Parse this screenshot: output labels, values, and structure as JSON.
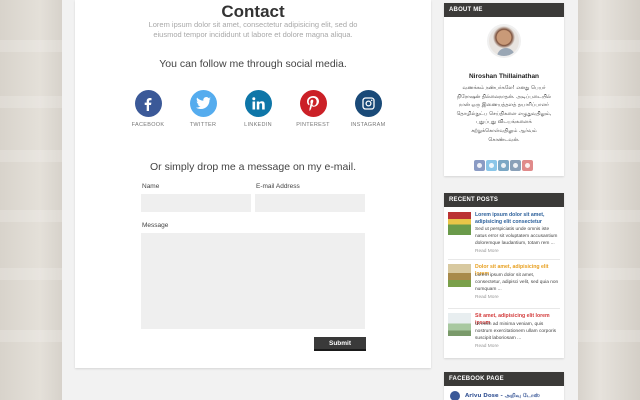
{
  "colors": {
    "facebook": "#3b5998",
    "twitter": "#55acee",
    "linkedin": "#0e76a8",
    "pinterest": "#cb2027",
    "instagram": "#1a4a78",
    "widget_header": "#3b3a38",
    "accent_orange": "#e8a020",
    "accent_red": "#d33b3b"
  },
  "contact": {
    "title": "Contact",
    "intro": "Lorem ipsum dolor sit amet, consectetur adipisicing elit, sed do eiusmod tempor incididunt ut labore et dolore magna aliqua.",
    "follow_heading": "You can follow me through social media.",
    "socials": [
      {
        "label": "FACEBOOK",
        "icon": "facebook-icon"
      },
      {
        "label": "TWITTER",
        "icon": "twitter-icon"
      },
      {
        "label": "LINKEDIN",
        "icon": "linkedin-icon"
      },
      {
        "label": "PINTEREST",
        "icon": "pinterest-icon"
      },
      {
        "label": "INSTAGRAM",
        "icon": "instagram-icon"
      }
    ],
    "email_heading": "Or simply drop me a message on my e-mail.",
    "form": {
      "name_label": "Name",
      "email_label": "E-mail Address",
      "message_label": "Message",
      "name_value": "",
      "email_value": "",
      "message_value": "",
      "submit_label": "Submit"
    }
  },
  "sidebar": {
    "about": {
      "header": "ABOUT ME",
      "name": "Niroshan Thillainathan",
      "bio": "வணக்கம் நண்பர்களே! எனது பெயர் நிரோஷன் தில்லைநாதன். அடிப்படையில் நான் ஒரு இணையத்தளத் தயாரிப்பாளர் தொழில்நுட்ப செய்திகளை எழுதுவதிலும், புதுப்புது விடயங்களைக் கற்றுக்கொள்வதிலும் ஆர்வம் கொண்டவன்.",
      "mini_socials": [
        {
          "icon": "facebook-icon",
          "color": "#8a9bc4"
        },
        {
          "icon": "twitter-icon",
          "color": "#8ac6e8"
        },
        {
          "icon": "linkedin-icon",
          "color": "#7aa7c4"
        },
        {
          "icon": "instagram-icon",
          "color": "#8aa0b8"
        },
        {
          "icon": "pinterest-icon",
          "color": "#e08a8a"
        }
      ]
    },
    "recent": {
      "header": "RECENT POSTS",
      "posts": [
        {
          "title": "Lorem ipsum dolor sit amet, adipisicing elit consectetur",
          "text": "Sed ut perspiciatis unde omnis iste natus error sit voluptatem accusantium doloremque laudantium, totam rem ...",
          "more": "Read More",
          "title_color": "#2b5f9a"
        },
        {
          "title": "Dolor sit amet, adipisicing elit lorem",
          "text": "Lorem ipsum dolor sit amet, consectetur, adipisci velit, sed quia non numquam ...",
          "more": "Read More",
          "title_color": "#e8a020"
        },
        {
          "title": "Sit amet, adipisicing elit lorem ipsum",
          "text": "Ut enim ad minima veniam, quis nostrum exercitationem ullam corporis suscipit laboriosam ...",
          "more": "Read More",
          "title_color": "#d33b3b"
        }
      ]
    },
    "facebook": {
      "header": "FACEBOOK PAGE",
      "page_name": "Arivu Dose - அறிவு டோஸ்"
    }
  }
}
